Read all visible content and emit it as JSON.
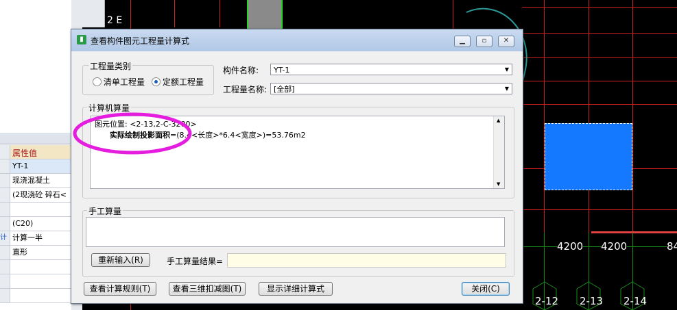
{
  "dialog": {
    "title": "查看构件图元工程量计算式",
    "category_group_label": "工程量类别",
    "radio_qingdan": "清单工程量",
    "radio_dinge": "定额工程量",
    "component_name_label": "构件名称:",
    "component_name_value": "YT-1",
    "quantity_name_label": "工程量名称:",
    "quantity_name_value": "[全部]",
    "computer_calc_label": "计算机算量",
    "calc_line1": "图元位置: <2-13,2-C-3200>",
    "calc_line2_bold": "实际绘制投影面积",
    "calc_line2_rest": "=(8.4<长度>*6.4<宽度>)=53.76m2",
    "manual_calc_label": "手工算量",
    "reinput_button": "重新输入(R)",
    "manual_result_label": "手工算量结果=",
    "manual_result_value": "",
    "view_rules_button": "查看计算规则(T)",
    "view_3d_button": "查看三维扣减图(T)",
    "show_detail_button": "显示详细计算式",
    "close_button": "关闭(C)"
  },
  "left_panel": {
    "header": "属性值",
    "rows": [
      "YT-1",
      "现浇混凝土",
      "(2现浇砼 碎石<",
      "",
      "(C20)",
      "计算一半",
      "直形",
      "",
      "",
      ""
    ],
    "row_marker": "计"
  },
  "canvas": {
    "axis_top_label": "2 E",
    "dim_labels": [
      "4200",
      "4200",
      "84"
    ],
    "axis_labels": [
      "2-12",
      "2-13",
      "2-14"
    ],
    "selected_color": "#1479ff",
    "highlight_color": "#e41ddf"
  }
}
